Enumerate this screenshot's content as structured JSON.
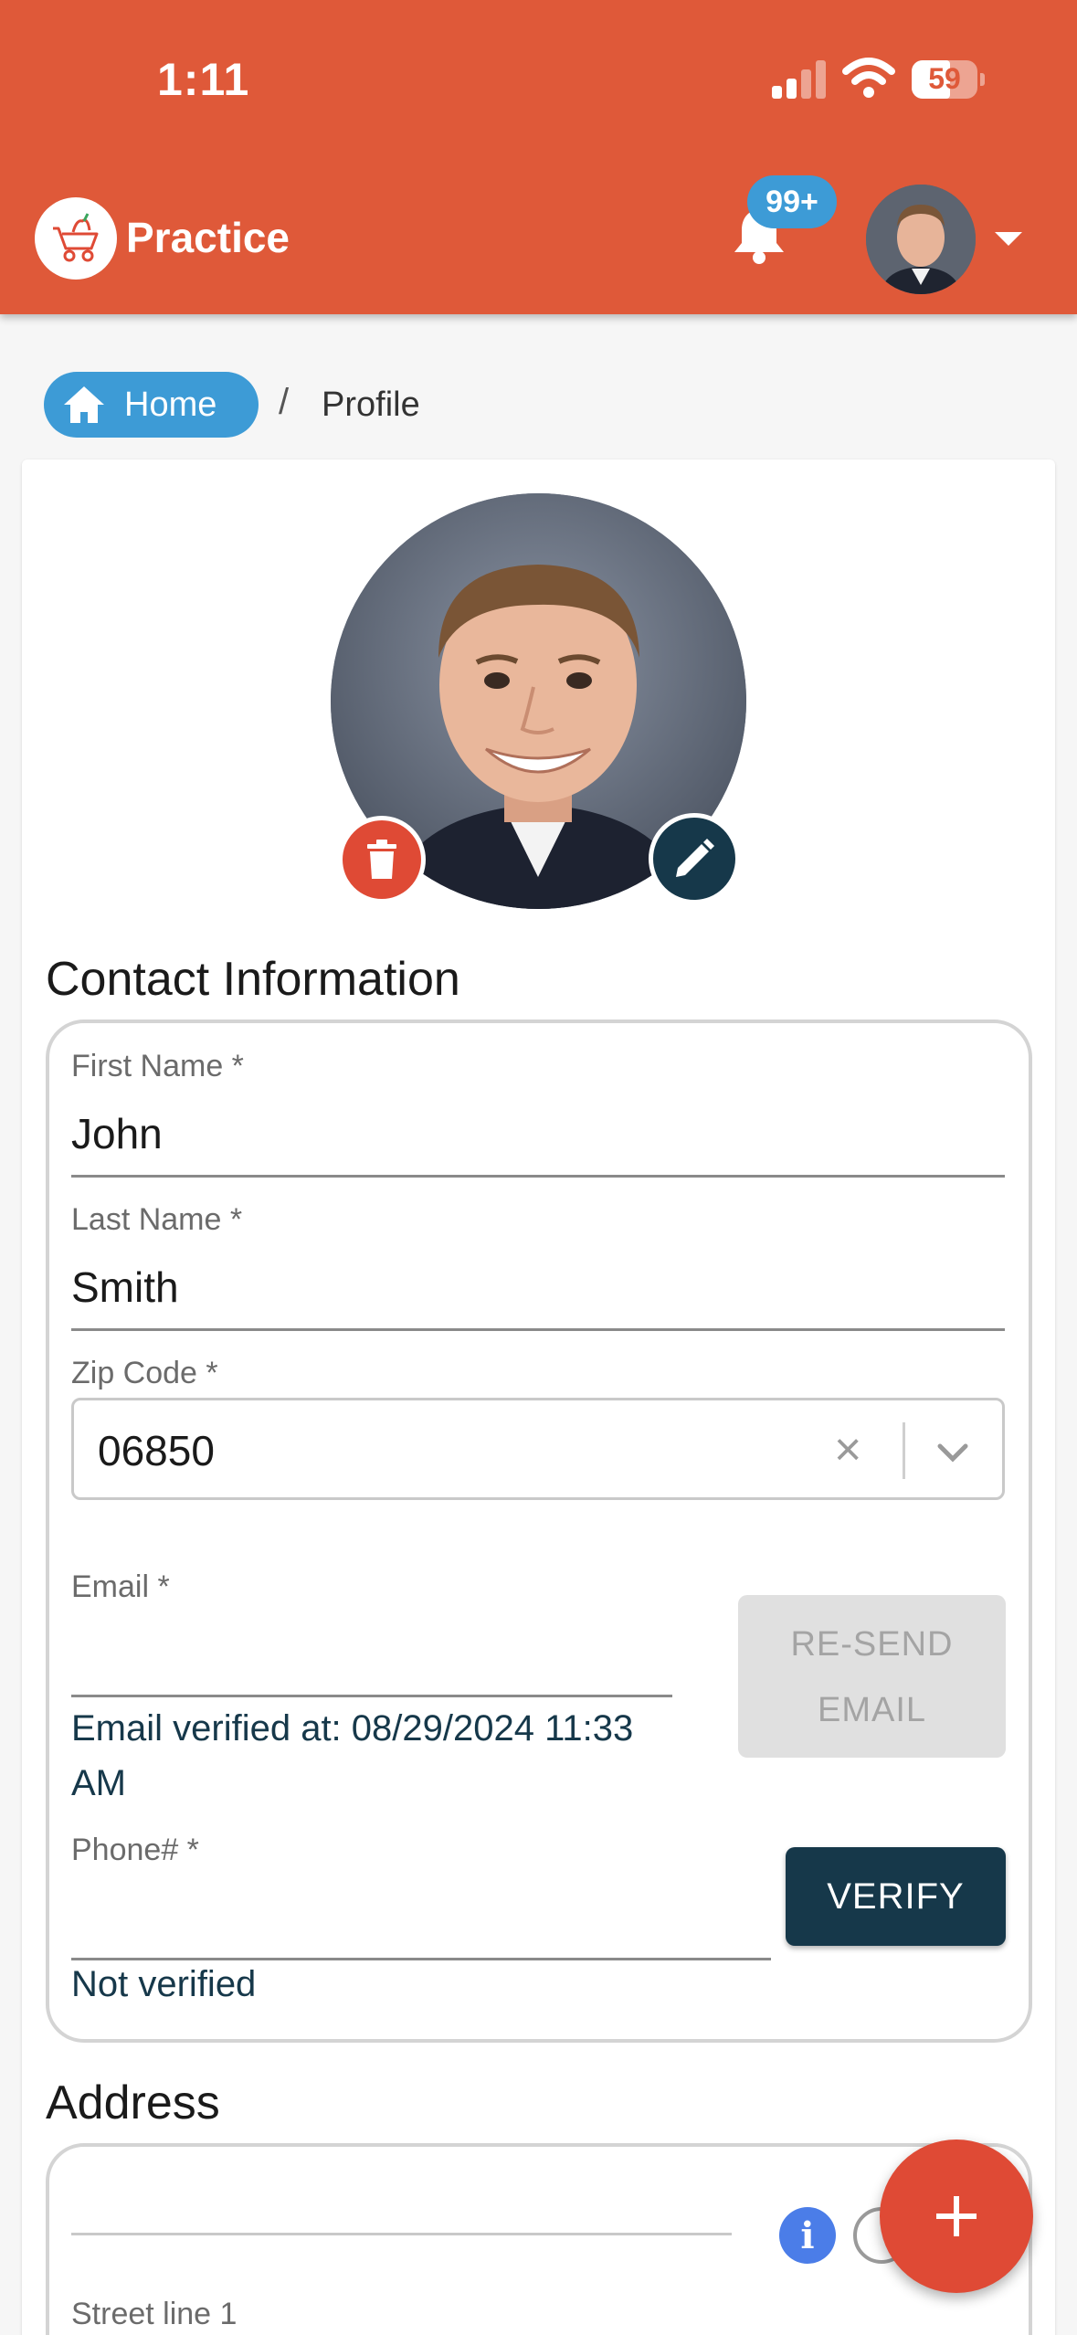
{
  "status_bar": {
    "time": "1:11",
    "battery": "59"
  },
  "header": {
    "app_title": "Practice",
    "notification_badge": "99+"
  },
  "breadcrumb": {
    "home": "Home",
    "separator": "/",
    "current": "Profile"
  },
  "contact": {
    "section_title": "Contact Information",
    "first_name_label": "First Name *",
    "first_name_value": "John",
    "last_name_label": "Last Name *",
    "last_name_value": "Smith",
    "zip_label": "Zip Code *",
    "zip_value": "06850",
    "zip_clear": "×",
    "email_label": "Email *",
    "resend_line1": "RE-SEND",
    "resend_line2": "EMAIL",
    "email_verified": "Email verified at: 08/29/2024 11:33 AM",
    "phone_label": "Phone# *",
    "verify_label": "VERIFY",
    "phone_status": "Not verified"
  },
  "address": {
    "section_title": "Address",
    "street_label": "Street line 1",
    "info_glyph": "i"
  },
  "colors": {
    "primary": "#df5939",
    "accent_blue": "#3d9bd6",
    "navy": "#16384a",
    "danger": "#df4a35"
  }
}
